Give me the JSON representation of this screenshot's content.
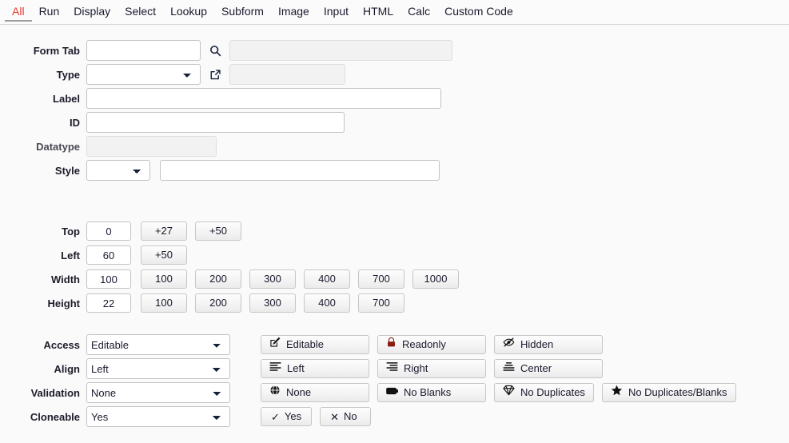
{
  "nav": {
    "tabs": [
      {
        "label": "All",
        "active": true
      },
      {
        "label": "Run",
        "active": false
      },
      {
        "label": "Display",
        "active": false
      },
      {
        "label": "Select",
        "active": false
      },
      {
        "label": "Lookup",
        "active": false
      },
      {
        "label": "Subform",
        "active": false
      },
      {
        "label": "Image",
        "active": false
      },
      {
        "label": "Input",
        "active": false
      },
      {
        "label": "HTML",
        "active": false
      },
      {
        "label": "Calc",
        "active": false
      },
      {
        "label": "Custom Code",
        "active": false
      }
    ],
    "active_color": "#e8392f"
  },
  "fields": {
    "form_tab": {
      "label": "Form Tab",
      "value": "",
      "search_icon": "search-icon",
      "readonly_value": ""
    },
    "type": {
      "label": "Type",
      "value": "",
      "options": [
        ""
      ],
      "open_icon": "external-link-icon",
      "readonly_value": ""
    },
    "label_field": {
      "label": "Label",
      "value": ""
    },
    "id": {
      "label": "ID",
      "value": ""
    },
    "datatype": {
      "label": "Datatype",
      "value": ""
    },
    "style": {
      "label": "Style",
      "value": "",
      "options": [
        ""
      ],
      "text_value": ""
    }
  },
  "geometry": {
    "top": {
      "label": "Top",
      "value": "0",
      "presets": [
        "+27",
        "+50"
      ]
    },
    "left": {
      "label": "Left",
      "value": "60",
      "presets": [
        "+50"
      ]
    },
    "width": {
      "label": "Width",
      "value": "100",
      "presets": [
        "100",
        "200",
        "300",
        "400",
        "700",
        "1000"
      ]
    },
    "height": {
      "label": "Height",
      "value": "22",
      "presets": [
        "100",
        "200",
        "300",
        "400",
        "700"
      ]
    }
  },
  "options": {
    "access": {
      "label": "Access",
      "value": "Editable",
      "choices": [
        "Editable",
        "Readonly",
        "Hidden"
      ],
      "buttons": [
        {
          "label": "Editable",
          "icon": "pencil-square-icon"
        },
        {
          "label": "Readonly",
          "icon": "lock-icon"
        },
        {
          "label": "Hidden",
          "icon": "eye-slash-icon"
        }
      ]
    },
    "align": {
      "label": "Align",
      "value": "Left",
      "choices": [
        "Left",
        "Right",
        "Center"
      ],
      "buttons": [
        {
          "label": "Left",
          "icon": "align-left-icon"
        },
        {
          "label": "Right",
          "icon": "align-right-icon"
        },
        {
          "label": "Center",
          "icon": "align-center-icon"
        }
      ]
    },
    "validation": {
      "label": "Validation",
      "value": "None",
      "choices": [
        "None",
        "No Blanks",
        "No Duplicates",
        "No Duplicates/Blanks"
      ],
      "buttons": [
        {
          "label": "None",
          "icon": "globe-icon"
        },
        {
          "label": "No Blanks",
          "icon": "filled-rect-icon"
        },
        {
          "label": "No Duplicates",
          "icon": "gem-icon"
        },
        {
          "label": "No Duplicates/Blanks",
          "icon": "star-icon"
        }
      ]
    },
    "cloneable": {
      "label": "Cloneable",
      "value": "Yes",
      "choices": [
        "Yes",
        "No"
      ],
      "buttons": [
        {
          "label": "Yes",
          "icon": "check-icon"
        },
        {
          "label": "No",
          "icon": "cross-icon"
        }
      ]
    }
  },
  "colors": {
    "background": "#fafafa",
    "accent_red": "#e8392f",
    "lock_red": "#8b1a13",
    "icon_navy": "#16213a",
    "border": "#c3c3c3"
  }
}
